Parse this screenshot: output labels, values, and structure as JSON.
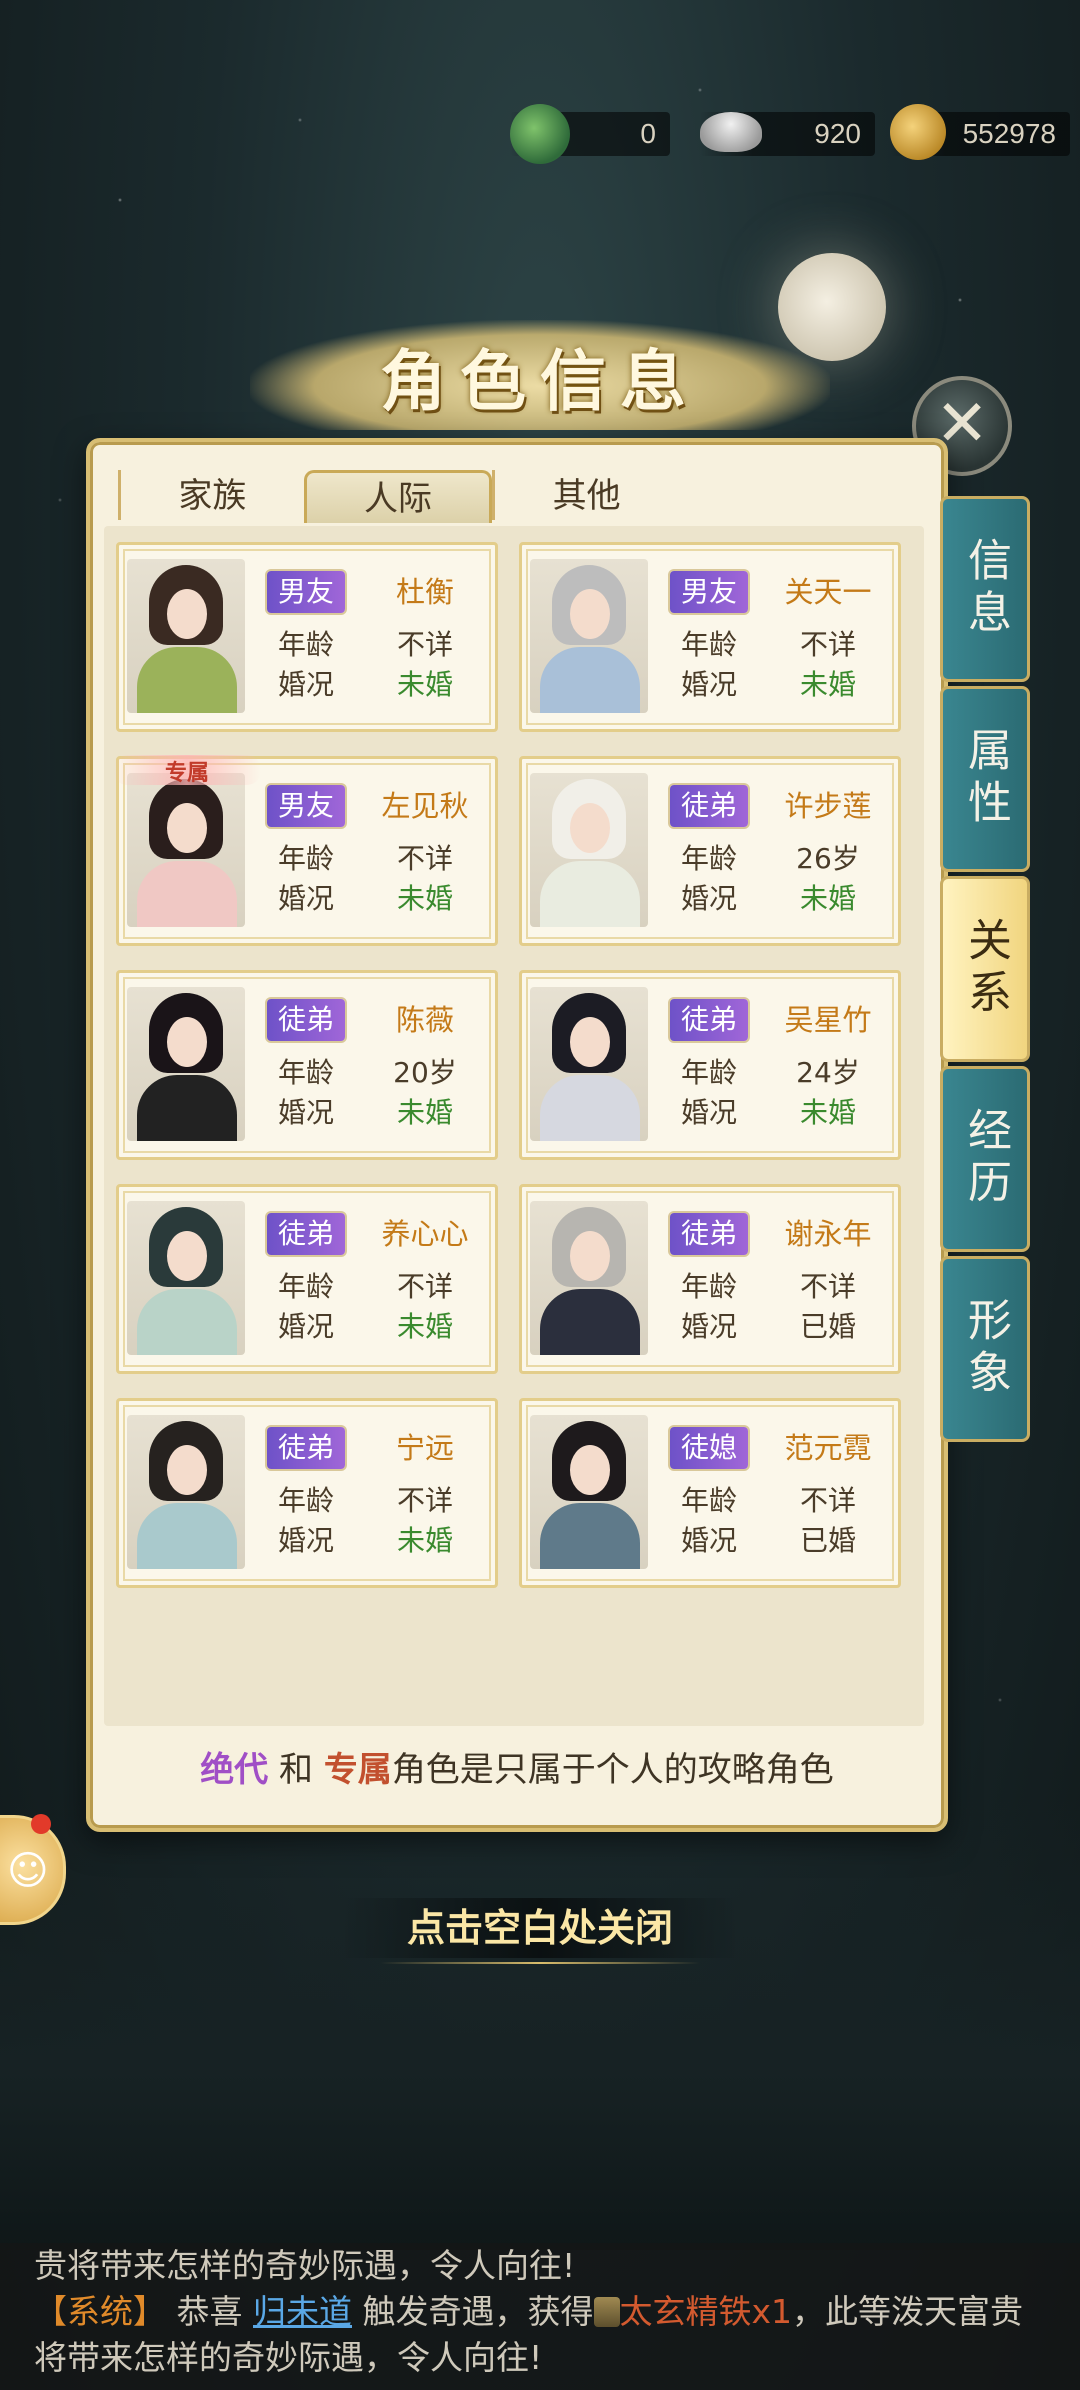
{
  "currency": [
    {
      "name": "jade",
      "icon": "jade-currency-icon",
      "value": "0"
    },
    {
      "name": "silver",
      "icon": "silver-ingot-icon",
      "value": "920"
    },
    {
      "name": "coin",
      "icon": "gold-coin-icon",
      "value": "552978"
    }
  ],
  "panel": {
    "title": "角色信息",
    "tabs": [
      {
        "label": "家族",
        "active": false
      },
      {
        "label": "人际",
        "active": true
      },
      {
        "label": "其他",
        "active": false
      }
    ],
    "cards": [
      {
        "role": "男友",
        "name": "杜衡",
        "age_label": "年龄",
        "age": "不详",
        "marital_label": "婚况",
        "marital": "未婚",
        "exclusive": ""
      },
      {
        "role": "男友",
        "name": "关天一",
        "age_label": "年龄",
        "age": "不详",
        "marital_label": "婚况",
        "marital": "未婚",
        "exclusive": ""
      },
      {
        "role": "男友",
        "name": "左见秋",
        "age_label": "年龄",
        "age": "不详",
        "marital_label": "婚况",
        "marital": "未婚",
        "exclusive": "专属"
      },
      {
        "role": "徒弟",
        "name": "许步莲",
        "age_label": "年龄",
        "age": "26岁",
        "marital_label": "婚况",
        "marital": "未婚",
        "exclusive": ""
      },
      {
        "role": "徒弟",
        "name": "陈薇",
        "age_label": "年龄",
        "age": "20岁",
        "marital_label": "婚况",
        "marital": "未婚",
        "exclusive": ""
      },
      {
        "role": "徒弟",
        "name": "吴星竹",
        "age_label": "年龄",
        "age": "24岁",
        "marital_label": "婚况",
        "marital": "未婚",
        "exclusive": ""
      },
      {
        "role": "徒弟",
        "name": "养心心",
        "age_label": "年龄",
        "age": "不详",
        "marital_label": "婚况",
        "marital": "未婚",
        "exclusive": ""
      },
      {
        "role": "徒弟",
        "name": "谢永年",
        "age_label": "年龄",
        "age": "不详",
        "marital_label": "婚况",
        "marital": "已婚",
        "exclusive": ""
      },
      {
        "role": "徒弟",
        "name": "宁远",
        "age_label": "年龄",
        "age": "不详",
        "marital_label": "婚况",
        "marital": "未婚",
        "exclusive": ""
      },
      {
        "role": "徒媳",
        "name": "范元霓",
        "age_label": "年龄",
        "age": "不详",
        "marital_label": "婚况",
        "marital": "已婚",
        "exclusive": ""
      }
    ],
    "footer": {
      "word1": "绝代",
      "connector": "和",
      "word2": "专属",
      "rest": "角色是只属于个人的攻略角色"
    }
  },
  "side_tabs": [
    {
      "label": "信息",
      "active": false
    },
    {
      "label": "属性",
      "active": false
    },
    {
      "label": "关系",
      "active": true
    },
    {
      "label": "经历",
      "active": false
    },
    {
      "label": "形象",
      "active": false
    }
  ],
  "close_hint": "点击空白处关闭",
  "chat": {
    "line1": "贵将带来怎样的奇妙际遇，令人向往!",
    "sys_tag": "【系统】",
    "congrats": "恭喜",
    "user": "归未道",
    "event": "触发奇遇，获得",
    "item": "太玄精铁x1",
    "tail": "，此等泼天富贵",
    "line3": "将带来怎样的奇妙际遇，令人向往!"
  }
}
